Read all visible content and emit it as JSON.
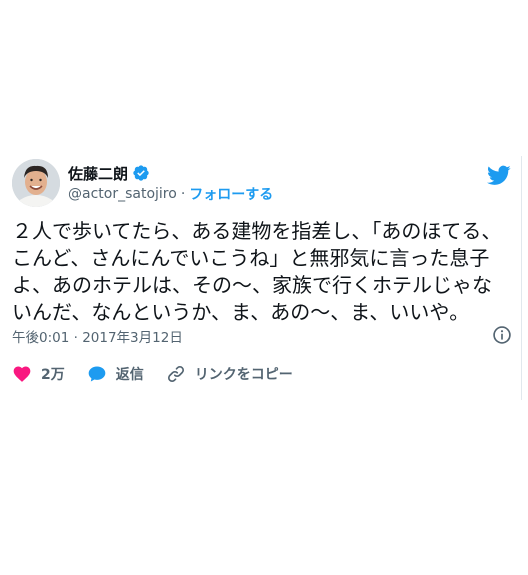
{
  "user": {
    "display_name": "佐藤二朗",
    "handle": "@actor_satojiro",
    "separator": "·",
    "follow_label": "フォローする"
  },
  "tweet": {
    "lines": [
      "２人で歩いてたら、ある建物を指差し、「あのほてる、",
      "こんど、さんにんでいこうね」と無邪気に言った息子",
      "よ、あのホテルは、その〜、家族で行くホテルじゃな",
      "いんだ、なんというか、ま、あの〜、ま、いいや。"
    ],
    "timestamp": "午後0:01 · 2017年3月12日"
  },
  "actions": {
    "like_count": "2万",
    "reply_label": "返信",
    "copy_link_label": "リンクをコピー"
  },
  "colors": {
    "brand_blue": "#1d9bf0",
    "like_pink": "#f91880",
    "secondary_text": "#536471"
  },
  "icons": [
    "avatar",
    "verified-badge-icon",
    "twitter-bird-icon",
    "info-icon",
    "heart-icon",
    "reply-bubble-icon",
    "link-icon"
  ]
}
